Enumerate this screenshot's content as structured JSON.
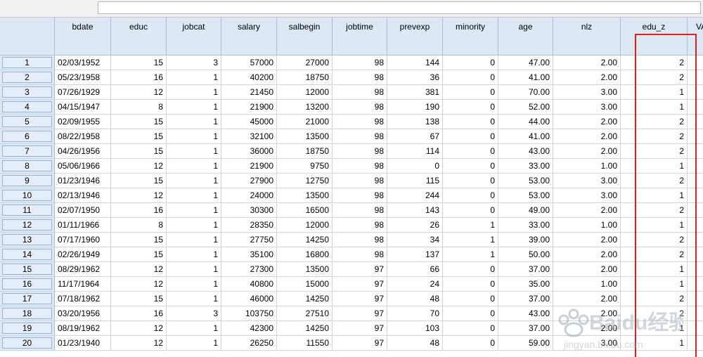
{
  "columns": [
    "bdate",
    "educ",
    "jobcat",
    "salary",
    "salbegin",
    "jobtime",
    "prevexp",
    "minority",
    "age",
    "nlz",
    "edu_z",
    "VA"
  ],
  "rows": [
    {
      "num": "1",
      "cells": [
        "02/03/1952",
        "15",
        "3",
        "57000",
        "27000",
        "98",
        "144",
        "0",
        "47.00",
        "2.00",
        "2"
      ]
    },
    {
      "num": "2",
      "cells": [
        "05/23/1958",
        "16",
        "1",
        "40200",
        "18750",
        "98",
        "36",
        "0",
        "41.00",
        "2.00",
        "2"
      ]
    },
    {
      "num": "3",
      "cells": [
        "07/26/1929",
        "12",
        "1",
        "21450",
        "12000",
        "98",
        "381",
        "0",
        "70.00",
        "3.00",
        "1"
      ]
    },
    {
      "num": "4",
      "cells": [
        "04/15/1947",
        "8",
        "1",
        "21900",
        "13200",
        "98",
        "190",
        "0",
        "52.00",
        "3.00",
        "1"
      ]
    },
    {
      "num": "5",
      "cells": [
        "02/09/1955",
        "15",
        "1",
        "45000",
        "21000",
        "98",
        "138",
        "0",
        "44.00",
        "2.00",
        "2"
      ]
    },
    {
      "num": "6",
      "cells": [
        "08/22/1958",
        "15",
        "1",
        "32100",
        "13500",
        "98",
        "67",
        "0",
        "41.00",
        "2.00",
        "2"
      ]
    },
    {
      "num": "7",
      "cells": [
        "04/26/1956",
        "15",
        "1",
        "36000",
        "18750",
        "98",
        "114",
        "0",
        "43.00",
        "2.00",
        "2"
      ]
    },
    {
      "num": "8",
      "cells": [
        "05/06/1966",
        "12",
        "1",
        "21900",
        "9750",
        "98",
        "0",
        "0",
        "33.00",
        "1.00",
        "1"
      ]
    },
    {
      "num": "9",
      "cells": [
        "01/23/1946",
        "15",
        "1",
        "27900",
        "12750",
        "98",
        "115",
        "0",
        "53.00",
        "3.00",
        "2"
      ]
    },
    {
      "num": "10",
      "cells": [
        "02/13/1946",
        "12",
        "1",
        "24000",
        "13500",
        "98",
        "244",
        "0",
        "53.00",
        "3.00",
        "1"
      ]
    },
    {
      "num": "11",
      "cells": [
        "02/07/1950",
        "16",
        "1",
        "30300",
        "16500",
        "98",
        "143",
        "0",
        "49.00",
        "2.00",
        "2"
      ]
    },
    {
      "num": "12",
      "cells": [
        "01/11/1966",
        "8",
        "1",
        "28350",
        "12000",
        "98",
        "26",
        "1",
        "33.00",
        "1.00",
        "1"
      ]
    },
    {
      "num": "13",
      "cells": [
        "07/17/1960",
        "15",
        "1",
        "27750",
        "14250",
        "98",
        "34",
        "1",
        "39.00",
        "2.00",
        "2"
      ]
    },
    {
      "num": "14",
      "cells": [
        "02/26/1949",
        "15",
        "1",
        "35100",
        "16800",
        "98",
        "137",
        "1",
        "50.00",
        "2.00",
        "2"
      ]
    },
    {
      "num": "15",
      "cells": [
        "08/29/1962",
        "12",
        "1",
        "27300",
        "13500",
        "97",
        "66",
        "0",
        "37.00",
        "2.00",
        "1"
      ]
    },
    {
      "num": "16",
      "cells": [
        "11/17/1964",
        "12",
        "1",
        "40800",
        "15000",
        "97",
        "24",
        "0",
        "35.00",
        "1.00",
        "1"
      ]
    },
    {
      "num": "17",
      "cells": [
        "07/18/1962",
        "15",
        "1",
        "46000",
        "14250",
        "97",
        "48",
        "0",
        "37.00",
        "2.00",
        "2"
      ]
    },
    {
      "num": "18",
      "cells": [
        "03/20/1956",
        "16",
        "3",
        "103750",
        "27510",
        "97",
        "70",
        "0",
        "43.00",
        "2.00",
        "2"
      ]
    },
    {
      "num": "19",
      "cells": [
        "08/19/1962",
        "12",
        "1",
        "42300",
        "14250",
        "97",
        "103",
        "0",
        "37.00",
        "2.00",
        "1"
      ]
    },
    {
      "num": "20",
      "cells": [
        "01/23/1940",
        "12",
        "1",
        "26250",
        "11550",
        "97",
        "48",
        "0",
        "59.00",
        "3.00",
        "1"
      ]
    }
  ],
  "watermark": {
    "brand": "Baidu经验",
    "url": "jingyan.baidu.com"
  },
  "colors": {
    "header_bg": "#dde8f5",
    "highlight": "#e02020"
  }
}
